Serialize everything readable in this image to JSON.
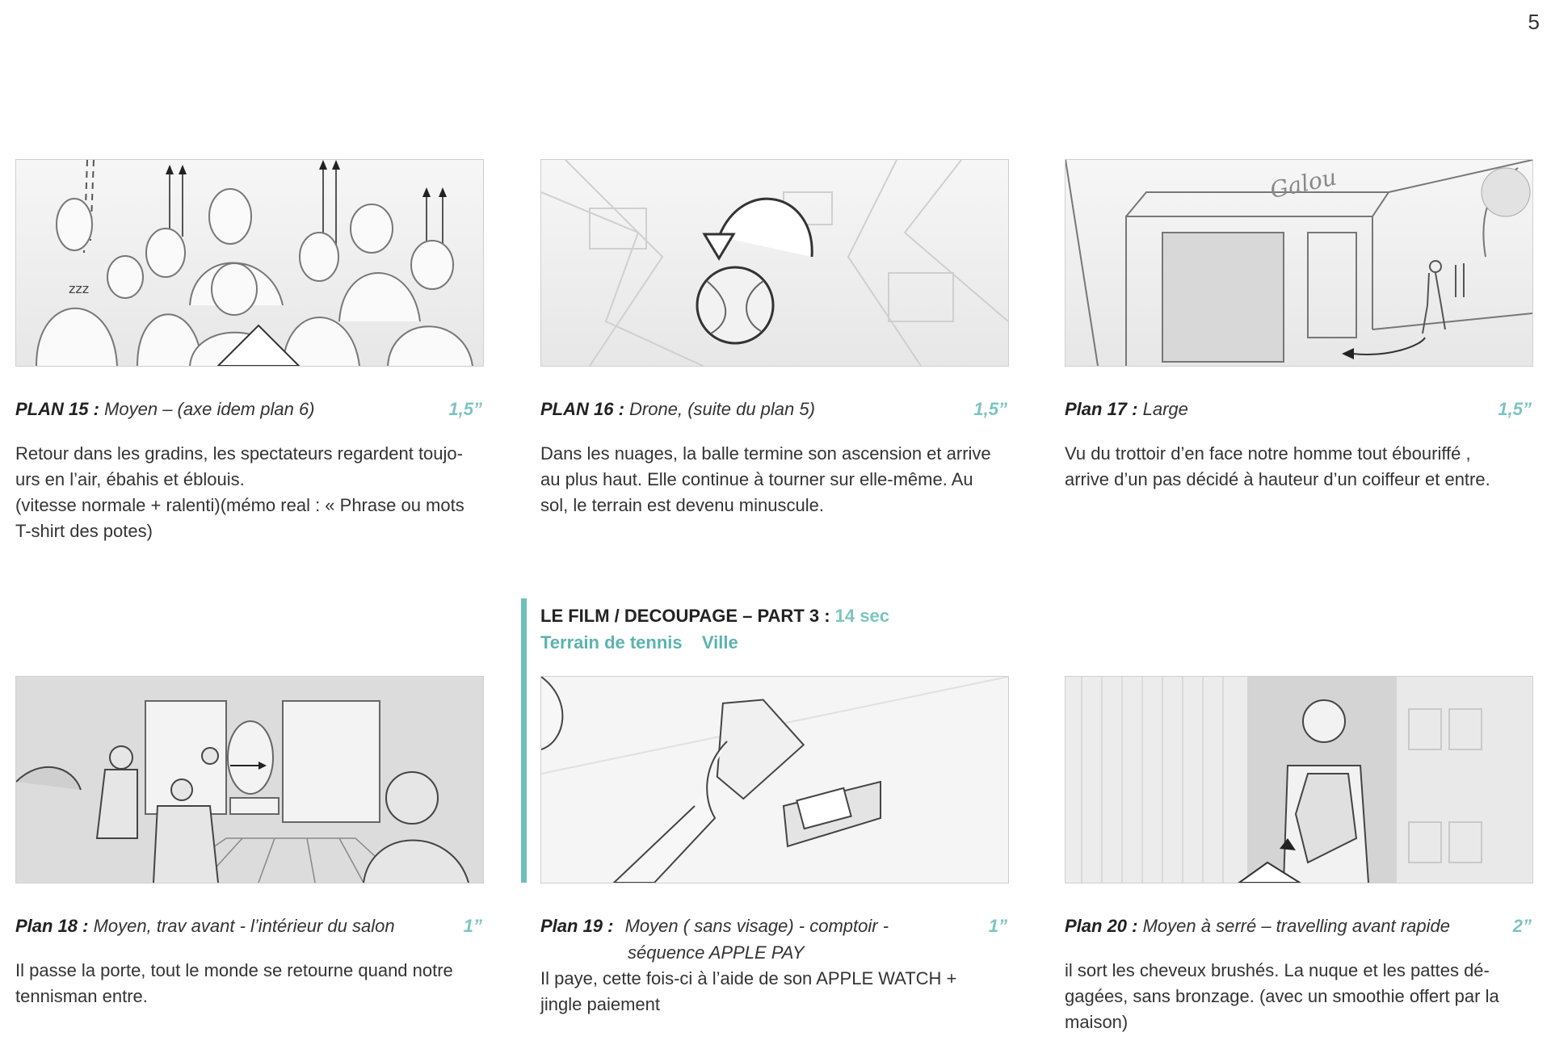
{
  "page_number": "5",
  "section": {
    "title": "LE FILM / DECOUPAGE – PART 3 :",
    "duration": "14 sec",
    "location_a": "Terrain de tennis",
    "location_b": "Ville"
  },
  "panels": [
    {
      "label": "PLAN 15 :",
      "desc": "Moyen – (axe  idem plan 6)",
      "desc2": "",
      "duration": "1,5”",
      "text": [
        "Retour dans les gradins, les spectateurs regardent toujo-",
        "urs en l’air, ébahis et éblouis.",
        "(vitesse normale + ralenti)(mémo real : « Phrase ou mots",
        "T-shirt des potes)"
      ]
    },
    {
      "label": "PLAN 16 :",
      "desc": "Drone, (suite du plan 5)",
      "desc2": "",
      "duration": "1,5”",
      "text": [
        "Dans les nuages, la balle termine son ascension et arrive",
        "au plus haut. Elle continue  à tourner  sur elle-même. Au",
        "sol, le terrain est devenu minuscule."
      ]
    },
    {
      "label": "Plan 17 :",
      "desc": "Large",
      "desc2": "",
      "duration": "1,5”",
      "sign_text": "Galou",
      "text": [
        "Vu du trottoir d’en face notre homme tout ébouriffé ,",
        "arrive d’un pas décidé à hauteur d’un coiffeur et entre."
      ]
    },
    {
      "label": "Plan 18 :",
      "desc": "Moyen,  trav avant - l’intérieur du salon",
      "desc2": "",
      "duration": "1”",
      "text": [
        "Il passe la porte, tout le monde se retourne quand notre",
        "tennisman entre."
      ]
    },
    {
      "label": "Plan 19 :",
      "desc": "Moyen ( sans visage) -  comptoir -",
      "desc2": "séquence APPLE PAY",
      "duration": "1”",
      "text": [
        "Il paye, cette fois-ci  à l’aide de son APPLE WATCH +",
        "jingle paiement"
      ]
    },
    {
      "label": "Plan 20 :",
      "desc": "Moyen à serré – travelling avant rapide",
      "desc2": "",
      "duration": "2”",
      "text": [
        "il sort les cheveux brushés. La nuque et les pattes dé-",
        "gagées, sans bronzage. (avec un smoothie offert par la",
        "maison)"
      ]
    }
  ]
}
